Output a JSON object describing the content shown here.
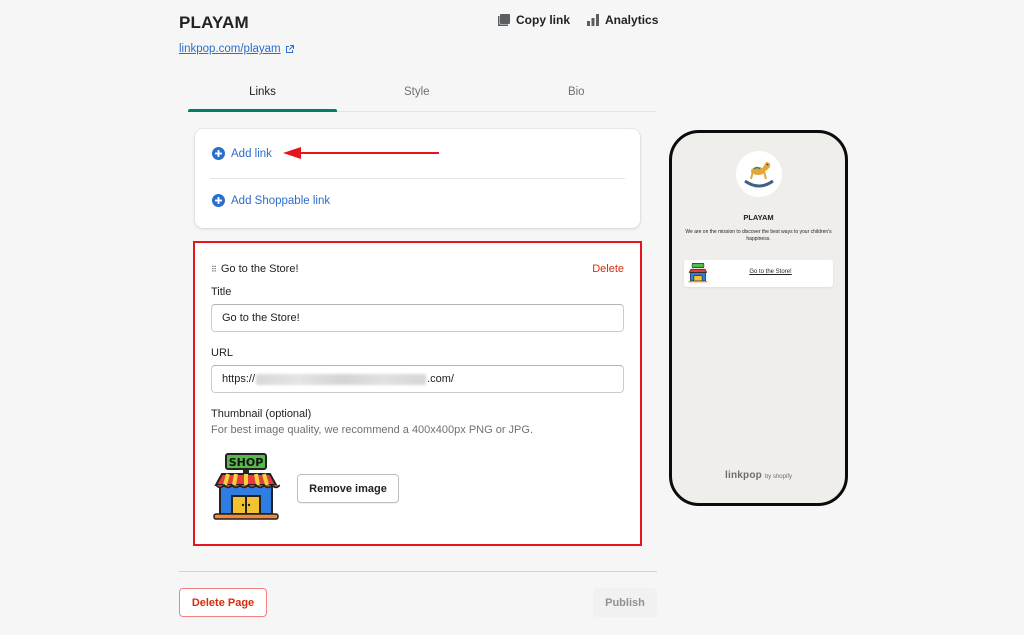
{
  "header": {
    "title": "PLAYAM",
    "url": "linkpop.com/playam",
    "actions": [
      {
        "label": "Copy link",
        "icon": "copy-icon"
      },
      {
        "label": "Analytics",
        "icon": "analytics-icon"
      }
    ]
  },
  "tabs": [
    {
      "label": "Links",
      "active": true
    },
    {
      "label": "Style",
      "active": false
    },
    {
      "label": "Bio",
      "active": false
    }
  ],
  "add_card": {
    "add_link_label": "Add link",
    "add_shoppable_label": "Add Shoppable link"
  },
  "link_card": {
    "heading": "Go to the Store!",
    "delete_label": "Delete",
    "title_label": "Title",
    "title_value": "Go to the Store!",
    "url_label": "URL",
    "url_prefix": "https://",
    "url_suffix": ".com/",
    "thumbnail_label": "Thumbnail (optional)",
    "thumbnail_help": "For best image quality, we recommend a 400x400px PNG or JPG.",
    "thumbnail_sign_text": "SHOP",
    "remove_image_label": "Remove image"
  },
  "footer": {
    "delete_page_label": "Delete Page",
    "publish_label": "Publish"
  },
  "preview": {
    "name": "PLAYAM",
    "bio": "We are on the mission to discover the best ways to your children's happiness.",
    "link_text": "Go to the Store!",
    "footer_brand": "linkpop",
    "footer_by": "by shopify"
  },
  "colors": {
    "accent_green": "#008060",
    "link_blue": "#2c6ecb",
    "critical_red": "#d72c0d",
    "annotation_red": "#e8141b"
  }
}
